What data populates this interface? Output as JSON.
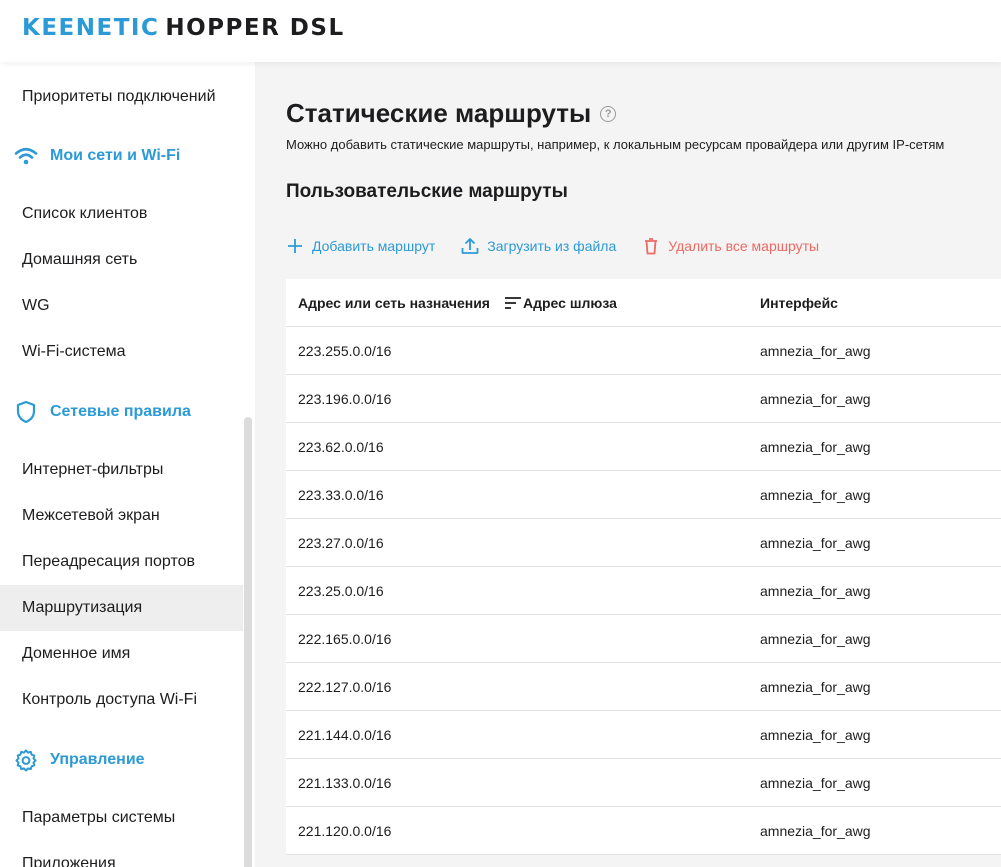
{
  "header": {
    "brand": "KEENETIC",
    "model": "HOPPER DSL"
  },
  "colors": {
    "accent": "#2c9ad6",
    "danger": "#ec6a63",
    "content_bg": "#f4f4f4",
    "active_item_bg": "#eeeeee"
  },
  "sidebar": {
    "items": [
      {
        "label": "Приоритеты подключений",
        "type": "item"
      },
      {
        "label": "Мои сети и Wi-Fi",
        "type": "section",
        "icon": "wifi-icon"
      },
      {
        "label": "Список клиентов",
        "type": "item"
      },
      {
        "label": "Домашняя сеть",
        "type": "item"
      },
      {
        "label": "WG",
        "type": "item"
      },
      {
        "label": "Wi-Fi-система",
        "type": "item"
      },
      {
        "label": "Сетевые правила",
        "type": "section",
        "icon": "shield-icon"
      },
      {
        "label": "Интернет-фильтры",
        "type": "item"
      },
      {
        "label": "Межсетевой экран",
        "type": "item"
      },
      {
        "label": "Переадресация портов",
        "type": "item"
      },
      {
        "label": "Маршрутизация",
        "type": "item",
        "active": true
      },
      {
        "label": "Доменное имя",
        "type": "item"
      },
      {
        "label": "Контроль доступа Wi-Fi",
        "type": "item"
      },
      {
        "label": "Управление",
        "type": "section",
        "icon": "gear-icon"
      },
      {
        "label": "Параметры системы",
        "type": "item"
      },
      {
        "label": "Приложения",
        "type": "item"
      }
    ]
  },
  "main": {
    "title": "Статические маршруты",
    "help_icon": "?",
    "description": "Можно добавить статические маршруты, например, к локальным ресурсам провайдера или другим IP-сетям",
    "section_title": "Пользовательские маршруты",
    "actions": {
      "add": "Добавить маршрут",
      "upload": "Загрузить из файла",
      "delete_all": "Удалить все маршруты"
    },
    "table": {
      "headers": {
        "destination": "Адрес или сеть назначения",
        "gateway": "Адрес шлюза",
        "interface": "Интерфейс"
      },
      "rows": [
        {
          "destination": "223.255.0.0/16",
          "gateway": "",
          "interface": "amnezia_for_awg"
        },
        {
          "destination": "223.196.0.0/16",
          "gateway": "",
          "interface": "amnezia_for_awg"
        },
        {
          "destination": "223.62.0.0/16",
          "gateway": "",
          "interface": "amnezia_for_awg"
        },
        {
          "destination": "223.33.0.0/16",
          "gateway": "",
          "interface": "amnezia_for_awg"
        },
        {
          "destination": "223.27.0.0/16",
          "gateway": "",
          "interface": "amnezia_for_awg"
        },
        {
          "destination": "223.25.0.0/16",
          "gateway": "",
          "interface": "amnezia_for_awg"
        },
        {
          "destination": "222.165.0.0/16",
          "gateway": "",
          "interface": "amnezia_for_awg"
        },
        {
          "destination": "222.127.0.0/16",
          "gateway": "",
          "interface": "amnezia_for_awg"
        },
        {
          "destination": "221.144.0.0/16",
          "gateway": "",
          "interface": "amnezia_for_awg"
        },
        {
          "destination": "221.133.0.0/16",
          "gateway": "",
          "interface": "amnezia_for_awg"
        },
        {
          "destination": "221.120.0.0/16",
          "gateway": "",
          "interface": "amnezia_for_awg"
        }
      ]
    }
  }
}
